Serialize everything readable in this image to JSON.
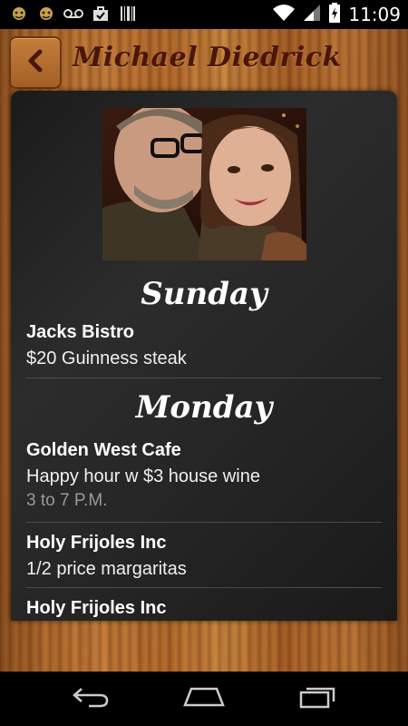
{
  "status_bar": {
    "time": "11:09",
    "left_icons": [
      "notification-icon",
      "notification-icon",
      "voicemail-icon",
      "briefcase-icon",
      "barcode-icon"
    ],
    "right_icons": [
      "wifi-icon",
      "signal-icon",
      "battery-charging-icon"
    ]
  },
  "header": {
    "title": "Michael Diedrick",
    "back_icon": "chevron-left-icon"
  },
  "schedule": [
    {
      "day": "Sunday",
      "entries": [
        {
          "name": "Jacks Bistro",
          "desc": "$20 Guinness steak"
        }
      ]
    },
    {
      "day": "Monday",
      "entries": [
        {
          "name": "Golden West Cafe",
          "desc": "Happy hour w $3 house wine",
          "time": "3  to 7 P.M."
        },
        {
          "name": "Holy Frijoles Inc",
          "desc": "1/2 price margaritas"
        },
        {
          "name": "Holy Frijoles Inc"
        }
      ]
    }
  ],
  "nav_bar": {
    "icons": [
      "back-icon",
      "home-icon",
      "recent-apps-icon"
    ]
  }
}
